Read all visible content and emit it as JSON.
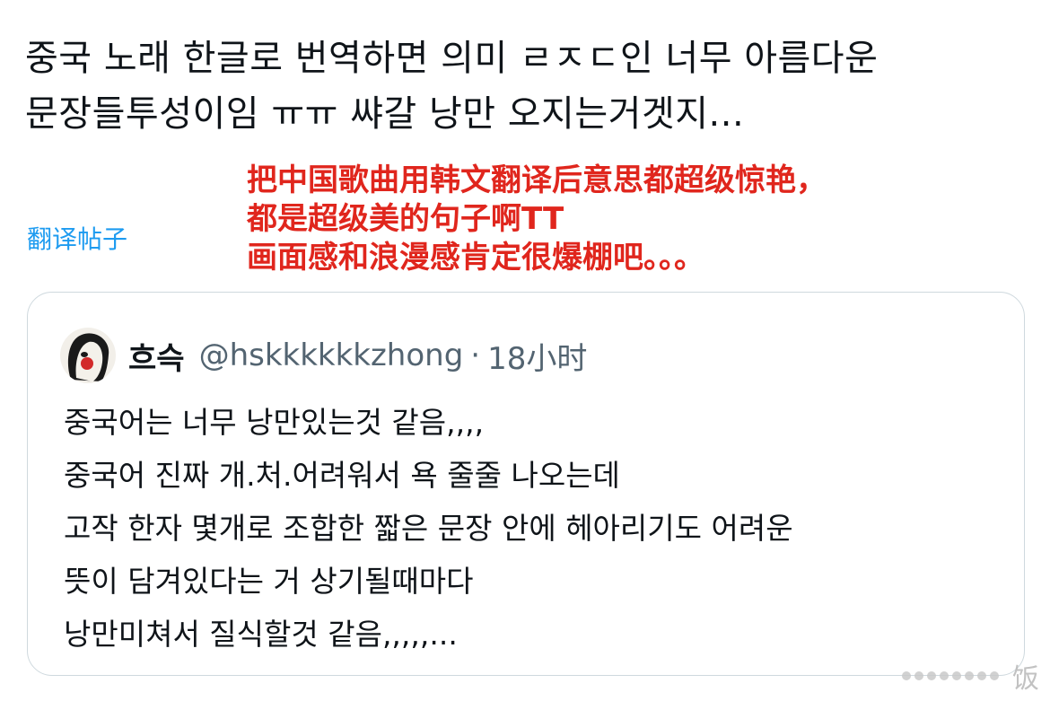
{
  "tweet": {
    "text_lines": [
      "중국 노래 한글로 번역하면 의미 ㄹㅈㄷ인 너무 아름다운",
      "문장들투성이임 ㅠㅠ 쌰갈 낭만 오지는거겟지..."
    ],
    "translate_link": "翻译帖子"
  },
  "overlay": {
    "lines": [
      "把中国歌曲用韩文翻译后意思都超级惊艳，",
      "都是超级美的句子啊TT",
      "画面感和浪漫感肯定很爆棚吧。。。"
    ],
    "color": "#e0261d"
  },
  "quote": {
    "author_name": "흐슥",
    "handle": "@hskkkkkkzhong",
    "separator": "·",
    "time": "18小时",
    "body_lines": [
      "중국어는 너무 낭만있는것 같음,,,,",
      "중국어 진짜 개.처.어려워서 욕 줄줄 나오는데",
      "고작 한자 몇개로 조합한 짧은 문장 안에 헤아리기도 어려운",
      "뜻이 담겨있다는 거 상기될때마다",
      "낭만미쳐서 질식할것 같음,,,,,..."
    ]
  },
  "watermark": {
    "text": "饭"
  },
  "colors": {
    "link": "#1d9bf0",
    "text": "#0f1419",
    "secondary": "#536471",
    "border": "#cfd9de"
  }
}
